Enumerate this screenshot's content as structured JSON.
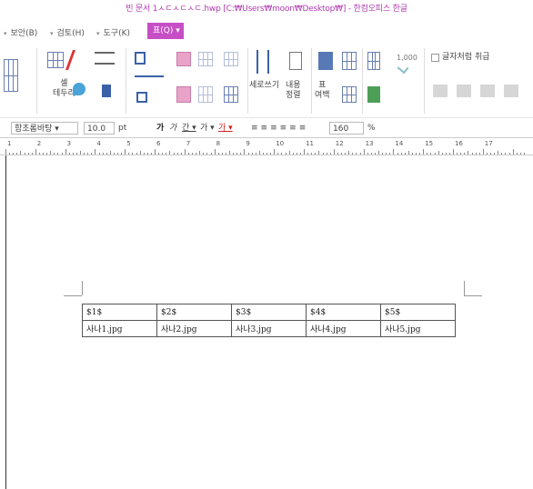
{
  "window": {
    "title": "빈 문서 1ㅅㄷㅅㄷㅅㄷ.hwp [C:₩Users₩moon₩Desktop₩] - 한컴오피스 한글"
  },
  "menu": {
    "items": [
      {
        "label": "보안(B)"
      },
      {
        "label": "검토(H)"
      },
      {
        "label": "도구(K)"
      }
    ],
    "active": {
      "label": "표(Q)"
    }
  },
  "ribbon": {
    "cell_border_label": "셀\n테두리",
    "vertical_write_label": "세로쓰기",
    "content_align_label": "내용\n정렬",
    "table_margin_label": "표\n여백",
    "number_value": "1,000",
    "treat_as_char_label": "글자처럼 취급"
  },
  "format_bar": {
    "font_name": "함초롬바탕",
    "font_size": "10.0",
    "size_unit": "pt",
    "line_spacing": "160",
    "line_spacing_unit": "%"
  },
  "ruler": {
    "numbers": [
      "1",
      "2",
      "3",
      "4",
      "5",
      "6",
      "7",
      "8",
      "9",
      "10",
      "11",
      "12",
      "13",
      "14",
      "15",
      "16",
      "17"
    ]
  },
  "table": {
    "rows": [
      [
        "$1$",
        "$2$",
        "$3$",
        "$4$",
        "$5$"
      ],
      [
        "사나1.jpg",
        "사나2.jpg",
        "사나3.jpg",
        "사나4.jpg",
        "사나5.jpg"
      ]
    ]
  },
  "colors": {
    "accent": "#c64fc6",
    "title_text": "#b03bb0"
  }
}
